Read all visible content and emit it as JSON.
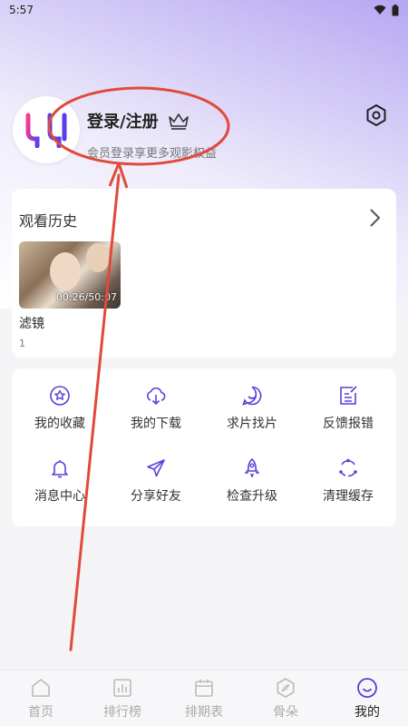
{
  "status_bar": {
    "time": "5:57"
  },
  "profile": {
    "title": "登录/注册",
    "subtitle": "会员登录享更多观影权益"
  },
  "history": {
    "heading": "观看历史",
    "items": [
      {
        "title": "滤镜",
        "episode": "1",
        "progress": "00:26/50:07"
      }
    ]
  },
  "features": [
    {
      "label": "我的收藏",
      "icon": "star-icon"
    },
    {
      "label": "我的下载",
      "icon": "cloud-download-icon"
    },
    {
      "label": "求片找片",
      "icon": "smile-chat-icon"
    },
    {
      "label": "反馈报错",
      "icon": "edit-icon"
    },
    {
      "label": "消息中心",
      "icon": "bell-icon"
    },
    {
      "label": "分享好友",
      "icon": "paper-plane-icon"
    },
    {
      "label": "检查升级",
      "icon": "rocket-icon"
    },
    {
      "label": "清理缓存",
      "icon": "cycle-icon"
    }
  ],
  "tabs": [
    {
      "label": "首页",
      "icon": "home-icon",
      "active": false
    },
    {
      "label": "排行榜",
      "icon": "chart-icon",
      "active": false
    },
    {
      "label": "排期表",
      "icon": "calendar-icon",
      "active": false
    },
    {
      "label": "骨朵",
      "icon": "compass-icon",
      "active": false
    },
    {
      "label": "我的",
      "icon": "smile-icon",
      "active": true
    }
  ],
  "colors": {
    "accent": "#5a40d8",
    "annotation": "#e04a3a"
  }
}
